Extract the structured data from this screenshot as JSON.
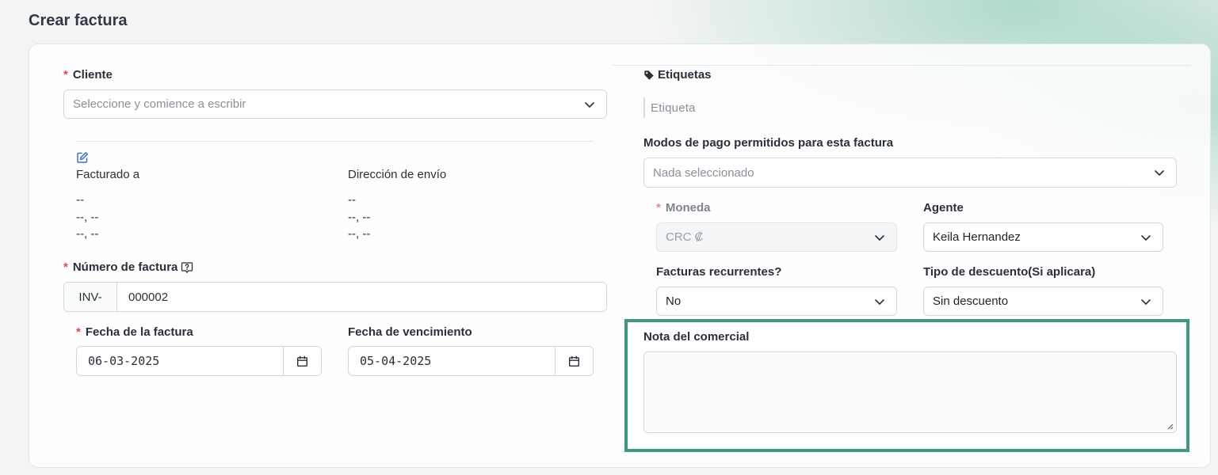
{
  "page": {
    "title": "Crear factura"
  },
  "client": {
    "label": "Cliente",
    "placeholder": "Seleccione y comience a escribir"
  },
  "address": {
    "billed_label": "Facturado a",
    "billed_lines": [
      "--",
      "--, --",
      "--, --"
    ],
    "shipping_label": "Dirección de envío",
    "shipping_lines": [
      "--",
      "--, --",
      "--, --"
    ]
  },
  "invoice_number": {
    "label": "Número de factura",
    "prefix": "INV-",
    "value": "000002"
  },
  "invoice_date": {
    "label": "Fecha de la factura",
    "value": "06-03-2025"
  },
  "due_date": {
    "label": "Fecha de vencimiento",
    "value": "05-04-2025"
  },
  "tags": {
    "label": "Etiquetas",
    "placeholder": "Etiqueta"
  },
  "payment_modes": {
    "label": "Modos de pago permitidos para esta factura",
    "placeholder": "Nada seleccionado"
  },
  "currency": {
    "label": "Moneda",
    "value": "CRC ₡"
  },
  "agent": {
    "label": "Agente",
    "value": "Keila Hernandez"
  },
  "recurring": {
    "label": "Facturas recurrentes?",
    "value": "No"
  },
  "discount": {
    "label": "Tipo de descuento(Si aplicara)",
    "value": "Sin descuento"
  },
  "sales_note": {
    "label": "Nota del comercial",
    "value": ""
  },
  "colors": {
    "accent_highlight": "#3f9a7c",
    "required": "#e0484f",
    "edit_icon": "#3b6fd8"
  },
  "icons": [
    "chevron-down-icon",
    "edit-icon",
    "help-icon",
    "tag-icon",
    "calendar-icon"
  ]
}
